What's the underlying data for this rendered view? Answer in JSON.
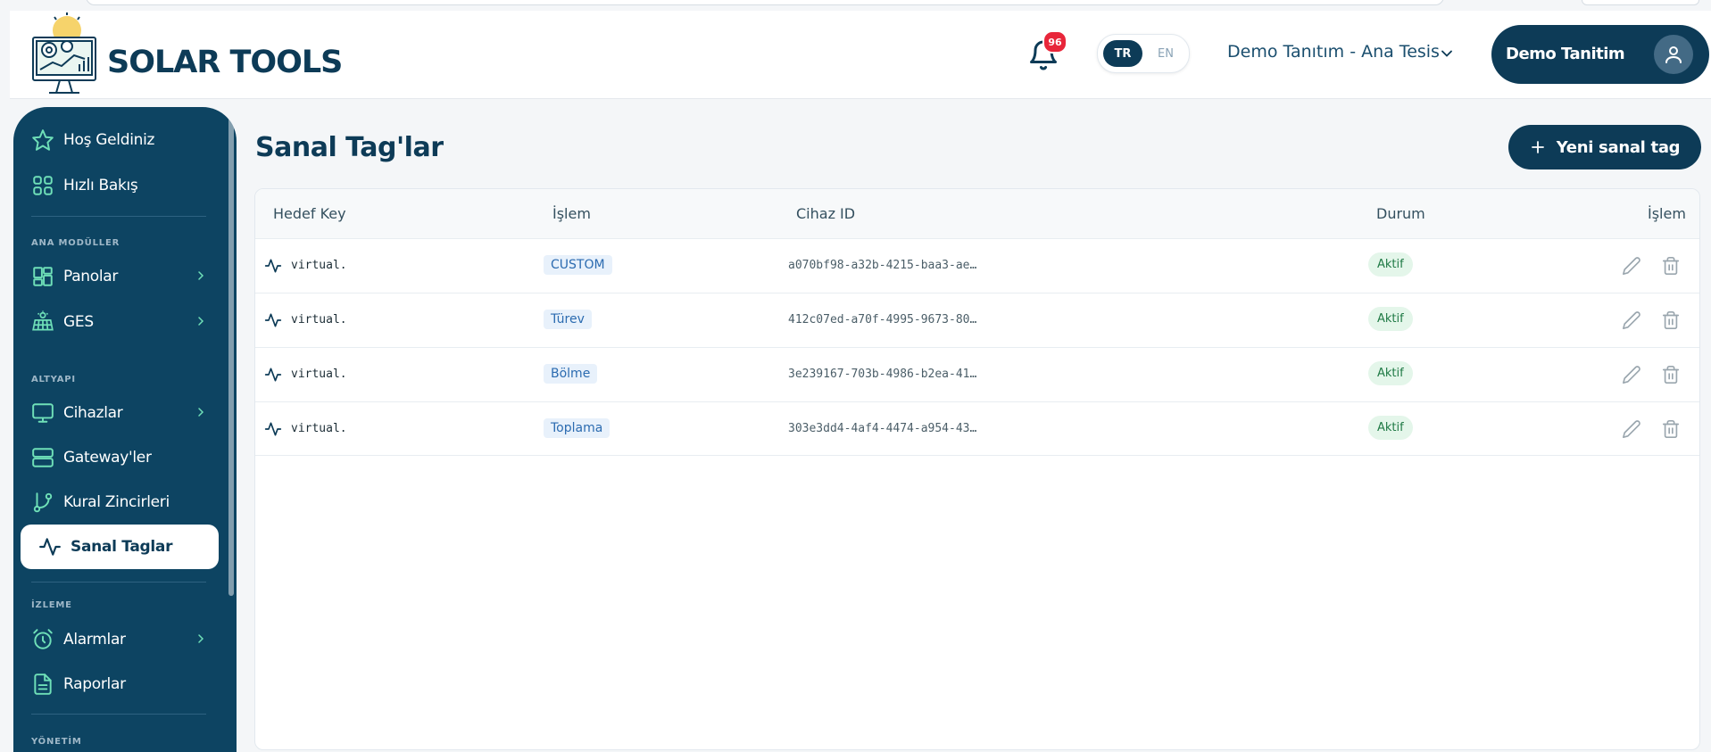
{
  "header": {
    "brand": "SOLAR TOOLS",
    "notifications_count": "96",
    "lang_active": "TR",
    "lang_other": "EN",
    "site_selector": "Demo Tanıtım - Ana Tesis",
    "user_name": "Demo Tanitim"
  },
  "sidebar": {
    "welcome": "Hoş Geldiniz",
    "overview": "Hızlı Bakış",
    "section_main": "ANA MODÜLLER",
    "panels": "Panolar",
    "ges": "GES",
    "section_infra": "ALTYAPI",
    "devices": "Cihazlar",
    "gateways": "Gateway'ler",
    "rule_chains": "Kural Zincirleri",
    "virtual_tags": "Sanal Taglar",
    "section_monitor": "İZLEME",
    "alarms": "Alarmlar",
    "reports": "Raporlar",
    "section_admin": "YÖNETİM"
  },
  "main": {
    "title": "Sanal Tag'lar",
    "new_button": "Yeni sanal tag",
    "columns": [
      "Hedef Key",
      "İşlem",
      "Cihaz ID",
      "Durum",
      "İşlem"
    ],
    "rows": [
      {
        "key": "virtual.",
        "op": "CUSTOM",
        "device": "a070bf98-a32b-4215-baa3-ae…",
        "status": "Aktif"
      },
      {
        "key": "virtual.",
        "op": "Türev",
        "device": "412c07ed-a70f-4995-9673-80…",
        "status": "Aktif"
      },
      {
        "key": "virtual.",
        "op": "Bölme",
        "device": "3e239167-703b-4986-b2ea-41…",
        "status": "Aktif"
      },
      {
        "key": "virtual.",
        "op": "Toplama",
        "device": "303e3dd4-4af4-4474-a954-43…",
        "status": "Aktif"
      }
    ]
  },
  "colors": {
    "primary": "#0d3b57",
    "sidebar": "#0d4462",
    "icon_accent": "#6fe0b8",
    "badge_red": "#e8263a",
    "status_green_bg": "#e4f6ea",
    "op_blue_bg": "#e8f1fb"
  }
}
